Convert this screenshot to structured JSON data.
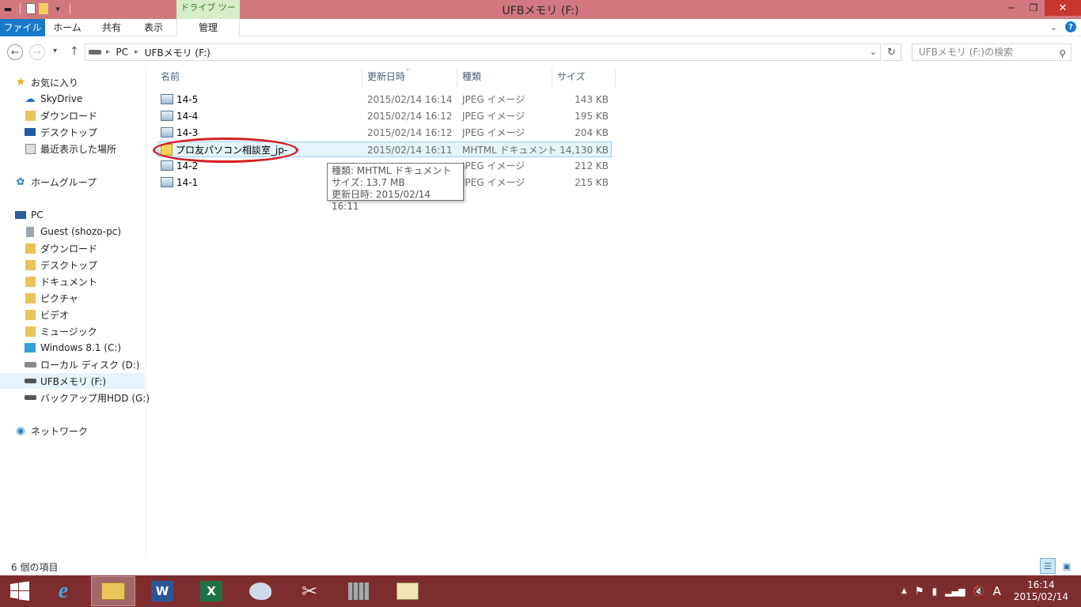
{
  "window": {
    "title": "UFBメモリ (F:)",
    "contextual_tab": "ドライブ ツール",
    "minimize_icon": "─",
    "maximize_icon": "❐",
    "close_icon": "✕"
  },
  "ribbon": {
    "tabs": [
      "ファイル",
      "ホーム",
      "共有",
      "表示",
      "管理"
    ]
  },
  "address": {
    "crumbs": [
      "PC",
      "UFBメモリ (F:)"
    ],
    "search_placeholder": "UFBメモリ (F:)の検索"
  },
  "sidebar": {
    "favorites_label": "お気に入り",
    "favorites": [
      "SkyDrive",
      "ダウンロード",
      "デスクトップ",
      "最近表示した場所"
    ],
    "homegroup_label": "ホームグループ",
    "pc_label": "PC",
    "pc_items": [
      "Guest (shozo-pc)",
      "ダウンロード",
      "デスクトップ",
      "ドキュメント",
      "ピクチャ",
      "ビデオ",
      "ミュージック",
      "Windows 8.1 (C:)",
      "ローカル ディスク (D:)",
      "UFBメモリ (F:)",
      "バックアップ用HDD (G:)"
    ],
    "network_label": "ネットワーク"
  },
  "columns": {
    "name": "名前",
    "date": "更新日時",
    "type": "種類",
    "size": "サイズ"
  },
  "files": [
    {
      "name": "14-5",
      "date": "2015/02/14 16:14",
      "type": "JPEG イメージ",
      "size": "143 KB"
    },
    {
      "name": "14-4",
      "date": "2015/02/14 16:12",
      "type": "JPEG イメージ",
      "size": "195 KB"
    },
    {
      "name": "14-3",
      "date": "2015/02/14 16:12",
      "type": "JPEG イメージ",
      "size": "204 KB"
    },
    {
      "name": "プロ友パソコン相談室_jp-",
      "date": "2015/02/14 16:11",
      "type": "MHTML ドキュメント",
      "size": "14,130 KB"
    },
    {
      "name": "14-2",
      "date": "",
      "type": "JPEG イメージ",
      "size": "212 KB"
    },
    {
      "name": "14-1",
      "date": "",
      "type": "JPEG イメージ",
      "size": "215 KB"
    }
  ],
  "tooltip": {
    "line1": "種類: MHTML ドキュメント",
    "line2": "サイズ: 13.7 MB",
    "line3": "更新日時: 2015/02/14 16:11"
  },
  "status": {
    "count": "6 個の項目"
  },
  "taskbar": {
    "ime": "A",
    "time": "16:14",
    "date": "2015/02/14"
  }
}
